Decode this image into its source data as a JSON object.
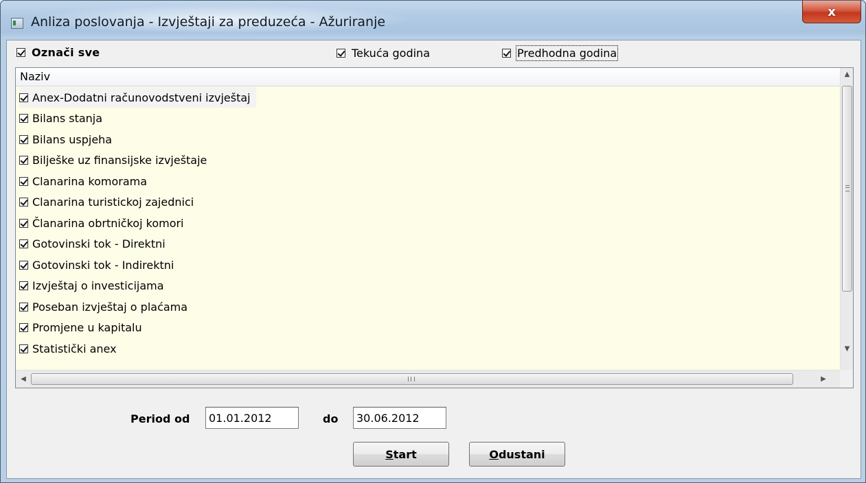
{
  "window": {
    "title": "Anliza poslovanja - Izvještaji za preduzeća - Ažuriranje",
    "close_label": "x"
  },
  "options": {
    "mark_all": "Označi sve",
    "current_year": "Tekuća godina",
    "previous_year": "Predhodna godina"
  },
  "list": {
    "header": "Naziv",
    "items": [
      "Anex-Dodatni računovodstveni izvještaj",
      "Bilans stanja",
      "Bilans uspjeha",
      "Bilješke uz finansijske izvještaje",
      "Clanarina komorama",
      "Clanarina turistickoj zajednici",
      "Članarina obrtničkoj komori",
      "Gotovinski tok - Direktni",
      "Gotovinski tok - Indirektni",
      "Izvještaj o investicijama",
      "Poseban izvještaj o plaćama",
      "Promjene u kapitalu",
      "Statistički anex"
    ]
  },
  "period": {
    "from_label": "Period od",
    "from_value": "01.01.2012",
    "to_label": "do",
    "to_value": "30.06.2012"
  },
  "buttons": {
    "start_key": "S",
    "start_rest": "tart",
    "cancel_key": "O",
    "cancel_rest": "dustani"
  }
}
